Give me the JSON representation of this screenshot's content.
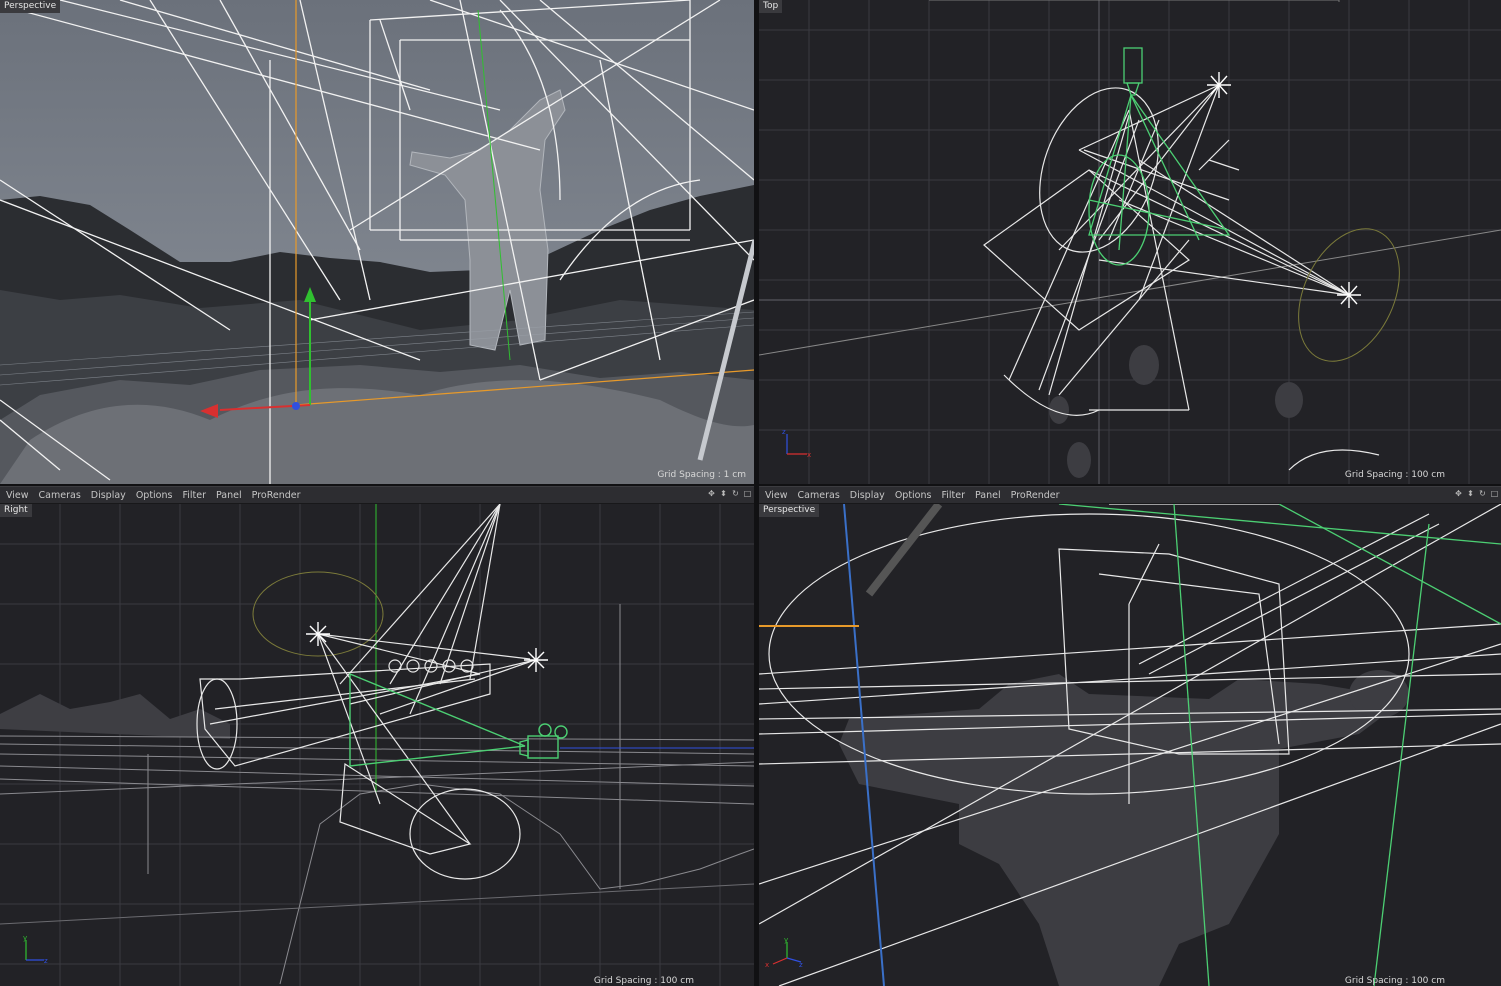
{
  "viewports": {
    "top_left": {
      "label": "Perspective",
      "grid_spacing": "Grid Spacing : 1 cm"
    },
    "top_right": {
      "label": "Top",
      "grid_spacing": "Grid Spacing : 100 cm"
    },
    "bottom_left": {
      "label": "Right",
      "grid_spacing": "Grid Spacing : 100 cm"
    },
    "bottom_right": {
      "label": "Perspective",
      "grid_spacing": "Grid Spacing : 100 cm"
    }
  },
  "menus": {
    "left": [
      "View",
      "Cameras",
      "Display",
      "Options",
      "Filter",
      "Panel",
      "ProRender"
    ],
    "right": [
      "View",
      "Cameras",
      "Display",
      "Options",
      "Filter",
      "Panel",
      "ProRender"
    ]
  },
  "nav_icons": [
    "move-icon",
    "zoom-icon",
    "rotate-icon",
    "maximize-icon"
  ],
  "colors": {
    "viewport_bg": "#222226",
    "grid": "#3a3a40",
    "wire": "#e8e8e8",
    "camera_green": "#4ccf73",
    "axis_x": "#d83030",
    "axis_y": "#30c030",
    "axis_z": "#3050e0",
    "selection_orange": "#e89a2a",
    "label_bg": "#3a3a3e",
    "menubar_bg": "#2d2d31"
  }
}
